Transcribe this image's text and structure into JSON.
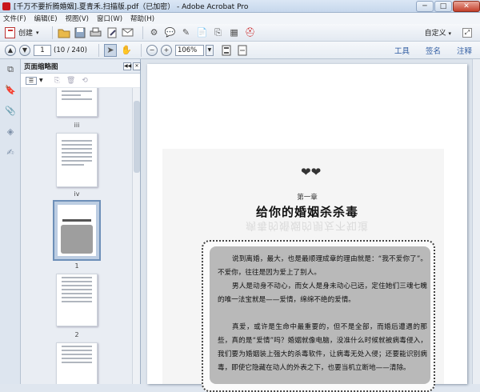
{
  "window": {
    "title": "[千万不要折腾婚姻].夏青禾.扫描版.pdf（已加密） - Adobe Acrobat Pro",
    "minimize": "─",
    "maximize": "□",
    "close": "✕"
  },
  "menubar": {
    "items": [
      "文件(F)",
      "编辑(E)",
      "视图(V)",
      "窗口(W)",
      "帮助(H)"
    ]
  },
  "toolbar": {
    "create_label": "创建",
    "create_arrow": "▾",
    "customize_label": "自定义",
    "customize_arrow": "▾"
  },
  "navbar": {
    "current_page": "1",
    "page_count": "(10 / 240)",
    "zoom": "106%",
    "links": [
      "工具",
      "签名",
      "注释"
    ]
  },
  "panel": {
    "title": "页面缩略图",
    "thumb_labels": [
      "iii",
      "iv",
      "1",
      "2"
    ]
  },
  "document": {
    "chapter": "第一章",
    "title": "给你的婚姻杀杀毒",
    "ghost": "病毒的婚姻的朋友不知道",
    "paragraphs": [
      "说到离婚，最大，也是最顺理成章的理由就是：“我不爱你了”。不爱你，往往是因为爱上了别人。",
      "男人是动身不动心，而女人是身未动心已远，定住她们三魂七魄的唯一法宝就是——爱情，绵绵不绝的爱情。",
      "真爱，或许是生命中最重要的，但不是全部，而婚后遭遇的那些，真的是“爱情”吗？婚姻就像电脑，没准什么时候就被病毒侵入，我们要为婚姻装上强大的杀毒软件，让病毒无处入侵；还要能识别病毒，即使它隐藏在动人的外表之下，也要当机立断地——清除。"
    ]
  }
}
